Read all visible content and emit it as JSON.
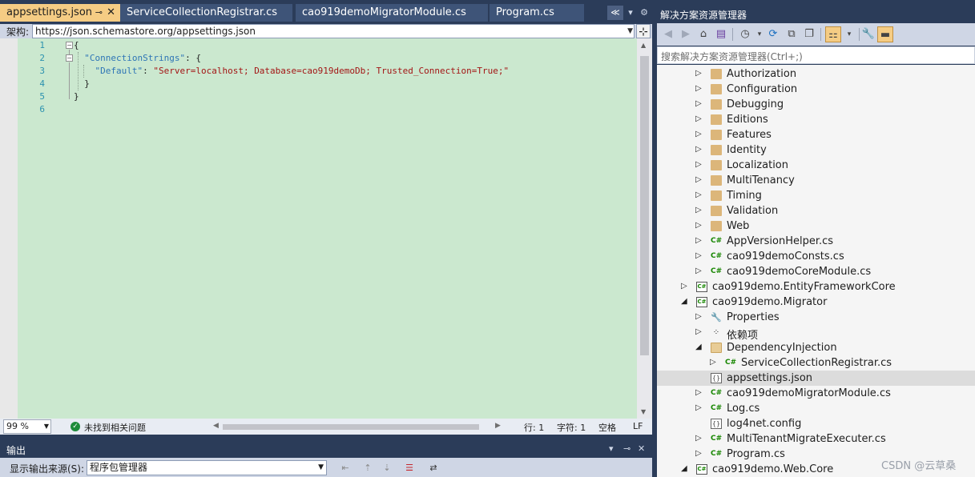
{
  "editor_tabs": [
    {
      "label": "appsettings.json",
      "active": true,
      "pin": "⊸",
      "close": "✕"
    },
    {
      "label": "ServiceCollectionRegistrar.cs",
      "active": false
    },
    {
      "label": "cao919demoMigratorModule.cs",
      "active": false
    },
    {
      "label": "Program.cs",
      "active": false
    }
  ],
  "tab_strip_buttons": {
    "overflow": "≪",
    "dropdown": "▾",
    "settings": "⚙"
  },
  "schema": {
    "label": "架构:",
    "url": "https://json.schemastore.org/appsettings.json"
  },
  "code_lines": [
    {
      "num": "1",
      "text": "{"
    },
    {
      "num": "2",
      "key": "\"ConnectionStrings\"",
      "rest": ": {"
    },
    {
      "num": "3",
      "key": "\"Default\"",
      "sep": ": ",
      "value": "\"Server=localhost; Database=cao919demoDb; Trusted_Connection=True;\""
    },
    {
      "num": "4",
      "text": "}"
    },
    {
      "num": "5",
      "text": "}"
    },
    {
      "num": "6",
      "text": ""
    }
  ],
  "status": {
    "zoom": "99 %",
    "issues": "未找到相关问题",
    "line": "行: 1",
    "char": "字符: 1",
    "whitespace": "空格",
    "eol": "LF"
  },
  "output": {
    "title": "输出",
    "source_label": "显示输出来源(S):",
    "source_value": "程序包管理器"
  },
  "solution_explorer": {
    "title": "解决方案资源管理器",
    "search_placeholder": "搜索解决方案资源管理器(Ctrl+;)",
    "items": [
      {
        "label": "Authorization",
        "type": "folder",
        "depth": 2,
        "expand": "▷"
      },
      {
        "label": "Configuration",
        "type": "folder",
        "depth": 2,
        "expand": "▷"
      },
      {
        "label": "Debugging",
        "type": "folder",
        "depth": 2,
        "expand": "▷"
      },
      {
        "label": "Editions",
        "type": "folder",
        "depth": 2,
        "expand": "▷"
      },
      {
        "label": "Features",
        "type": "folder",
        "depth": 2,
        "expand": "▷"
      },
      {
        "label": "Identity",
        "type": "folder",
        "depth": 2,
        "expand": "▷"
      },
      {
        "label": "Localization",
        "type": "folder",
        "depth": 2,
        "expand": "▷"
      },
      {
        "label": "MultiTenancy",
        "type": "folder",
        "depth": 2,
        "expand": "▷"
      },
      {
        "label": "Timing",
        "type": "folder",
        "depth": 2,
        "expand": "▷"
      },
      {
        "label": "Validation",
        "type": "folder",
        "depth": 2,
        "expand": "▷"
      },
      {
        "label": "Web",
        "type": "folder",
        "depth": 2,
        "expand": "▷"
      },
      {
        "label": "AppVersionHelper.cs",
        "type": "cs",
        "depth": 2,
        "expand": "▷"
      },
      {
        "label": "cao919demoConsts.cs",
        "type": "cs",
        "depth": 2,
        "expand": "▷"
      },
      {
        "label": "cao919demoCoreModule.cs",
        "type": "cs",
        "depth": 2,
        "expand": "▷"
      },
      {
        "label": "cao919demo.EntityFrameworkCore",
        "type": "proj",
        "depth": 1,
        "expand": "▷"
      },
      {
        "label": "cao919demo.Migrator",
        "type": "proj",
        "depth": 1,
        "expand": "◢"
      },
      {
        "label": "Properties",
        "type": "wrench",
        "depth": 2,
        "expand": "▷"
      },
      {
        "label": "依赖项",
        "type": "deps",
        "depth": 2,
        "expand": "▷"
      },
      {
        "label": "DependencyInjection",
        "type": "folder-open",
        "depth": 2,
        "expand": "◢"
      },
      {
        "label": "ServiceCollectionRegistrar.cs",
        "type": "cs",
        "depth": 3,
        "expand": "▷"
      },
      {
        "label": "appsettings.json",
        "type": "json",
        "depth": 2,
        "expand": "",
        "selected": true
      },
      {
        "label": "cao919demoMigratorModule.cs",
        "type": "cs",
        "depth": 2,
        "expand": "▷"
      },
      {
        "label": "Log.cs",
        "type": "cs",
        "depth": 2,
        "expand": "▷"
      },
      {
        "label": "log4net.config",
        "type": "json",
        "depth": 2,
        "expand": ""
      },
      {
        "label": "MultiTenantMigrateExecuter.cs",
        "type": "cs",
        "depth": 2,
        "expand": "▷"
      },
      {
        "label": "Program.cs",
        "type": "cs",
        "depth": 2,
        "expand": "▷"
      },
      {
        "label": "cao919demo.Web.Core",
        "type": "proj",
        "depth": 1,
        "expand": "◢"
      }
    ]
  },
  "watermark": "CSDN @云草桑"
}
